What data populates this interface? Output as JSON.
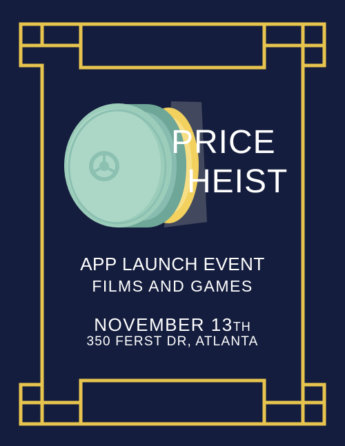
{
  "poster": {
    "title_line_1": "PRICE",
    "title_line_2": "HEIST",
    "event_name": "APP LAUNCH EVENT",
    "event_subtitle": "FILMS AND GAMES",
    "date_main": "NOVEMBER 13",
    "date_suffix": "TH",
    "address": "350 FERST DR, ATLANTA"
  },
  "colors": {
    "background": "#141d3d",
    "frame_gold": "#e7c44e",
    "vault_door": "#9ccdbb",
    "vault_shadow": "#6ea698",
    "vault_gold": "#f2d15f",
    "text": "#ffffff"
  },
  "icons": {
    "vault": "vault-door-icon"
  }
}
